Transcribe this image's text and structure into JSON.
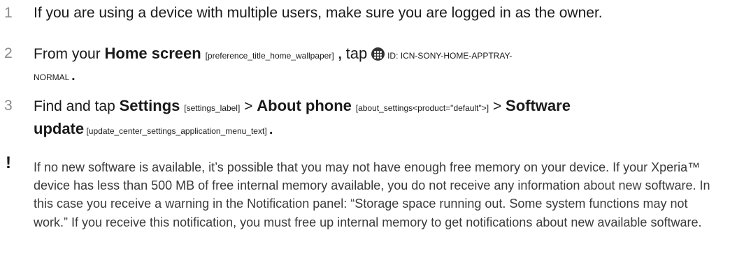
{
  "steps": [
    {
      "number": "1",
      "text": "If you are using a device with multiple users, make sure you are logged in as the owner."
    },
    {
      "number": "2",
      "from_text": "From your",
      "home_label": "Home screen",
      "home_res": "[preference_title_home_wallpaper]",
      "comma": ",",
      "tap": "tap",
      "icon_id": "ID: ICN-SONY-HOME-APPTRAY-",
      "icon_id_cont": "NORMAL",
      "period": "."
    },
    {
      "number": "3",
      "find_text": "Find and tap",
      "settings_label": "Settings",
      "settings_res": "[settings_label]",
      "sep1": ">",
      "about_label": "About phone",
      "about_res": "[about_settings<product=\"default\">]",
      "sep2": ">",
      "software_label": "Software",
      "update_label": "update",
      "update_res": "[update_center_settings_application_menu_text]",
      "period": "."
    }
  ],
  "note": {
    "icon": "exclamation-icon",
    "mark": "!",
    "text": "If no new software is available, it’s possible that you may not have enough free memory on your device. If your Xperia™ device has less than 500 MB of free internal memory available, you do not receive any information about new software. In this case you receive a warning in the Notification panel: “Storage space running out. Some system functions may not work.” If you receive this notification, you must free up internal memory to get notifications about new available software."
  }
}
